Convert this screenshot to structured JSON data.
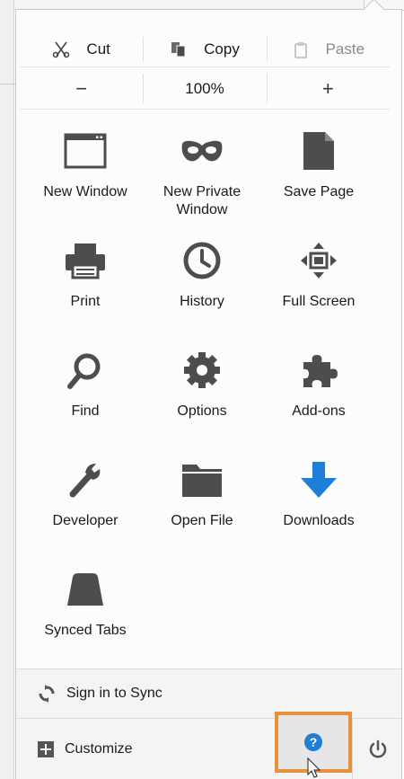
{
  "edit": {
    "cut": "Cut",
    "copy": "Copy",
    "paste": "Paste"
  },
  "zoom": {
    "out": "−",
    "level": "100%",
    "in": "+"
  },
  "tiles": [
    {
      "label": "New Window",
      "icon": "new-window-icon"
    },
    {
      "label": "New Private Window",
      "icon": "private-mask-icon"
    },
    {
      "label": "Save Page",
      "icon": "save-page-icon"
    },
    {
      "label": "Print",
      "icon": "printer-icon"
    },
    {
      "label": "History",
      "icon": "clock-icon"
    },
    {
      "label": "Full Screen",
      "icon": "fullscreen-arrows-icon"
    },
    {
      "label": "Find",
      "icon": "magnifier-icon"
    },
    {
      "label": "Options",
      "icon": "gear-icon"
    },
    {
      "label": "Add-ons",
      "icon": "puzzle-icon"
    },
    {
      "label": "Developer",
      "icon": "wrench-icon"
    },
    {
      "label": "Open File",
      "icon": "folder-icon"
    },
    {
      "label": "Downloads",
      "icon": "download-arrow-icon"
    },
    {
      "label": "Synced Tabs",
      "icon": "synced-tabs-icon"
    }
  ],
  "footer": {
    "sync": "Sign in to Sync",
    "customize": "Customize"
  },
  "colors": {
    "icon": "#4d4d4d",
    "download": "#1f7fd6",
    "help": "#1f7fd6",
    "highlight": "#e8913a"
  }
}
